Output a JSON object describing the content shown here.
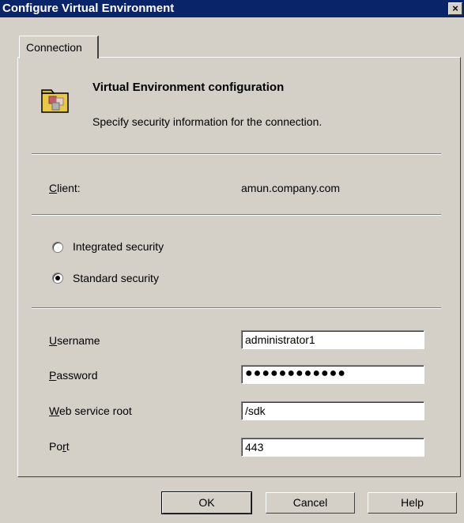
{
  "window": {
    "title": "Configure Virtual Environment",
    "close_glyph": "×"
  },
  "tabs": [
    {
      "label": "Connection",
      "selected": true
    }
  ],
  "header": {
    "title": "Virtual Environment configuration",
    "subtitle": "Specify security information for the connection.",
    "icon": "folder-config-icon"
  },
  "client": {
    "label": "Client:",
    "value": "amun.company.com"
  },
  "security": {
    "options": [
      {
        "label": "Integrated security",
        "selected": false
      },
      {
        "label": "Standard security",
        "selected": true
      }
    ]
  },
  "fields": {
    "username": {
      "label": "Username",
      "value": "administrator1"
    },
    "password": {
      "label": "Password",
      "value": "●●●●●●●●●●●●"
    },
    "web_service_root": {
      "label": "Web service root",
      "value": "/sdk"
    },
    "port": {
      "label": "Port",
      "value": "443"
    }
  },
  "buttons": {
    "ok": "OK",
    "cancel": "Cancel",
    "help": "Help"
  },
  "colors": {
    "titlebar": "#0a246a",
    "face": "#d4d0c8"
  }
}
